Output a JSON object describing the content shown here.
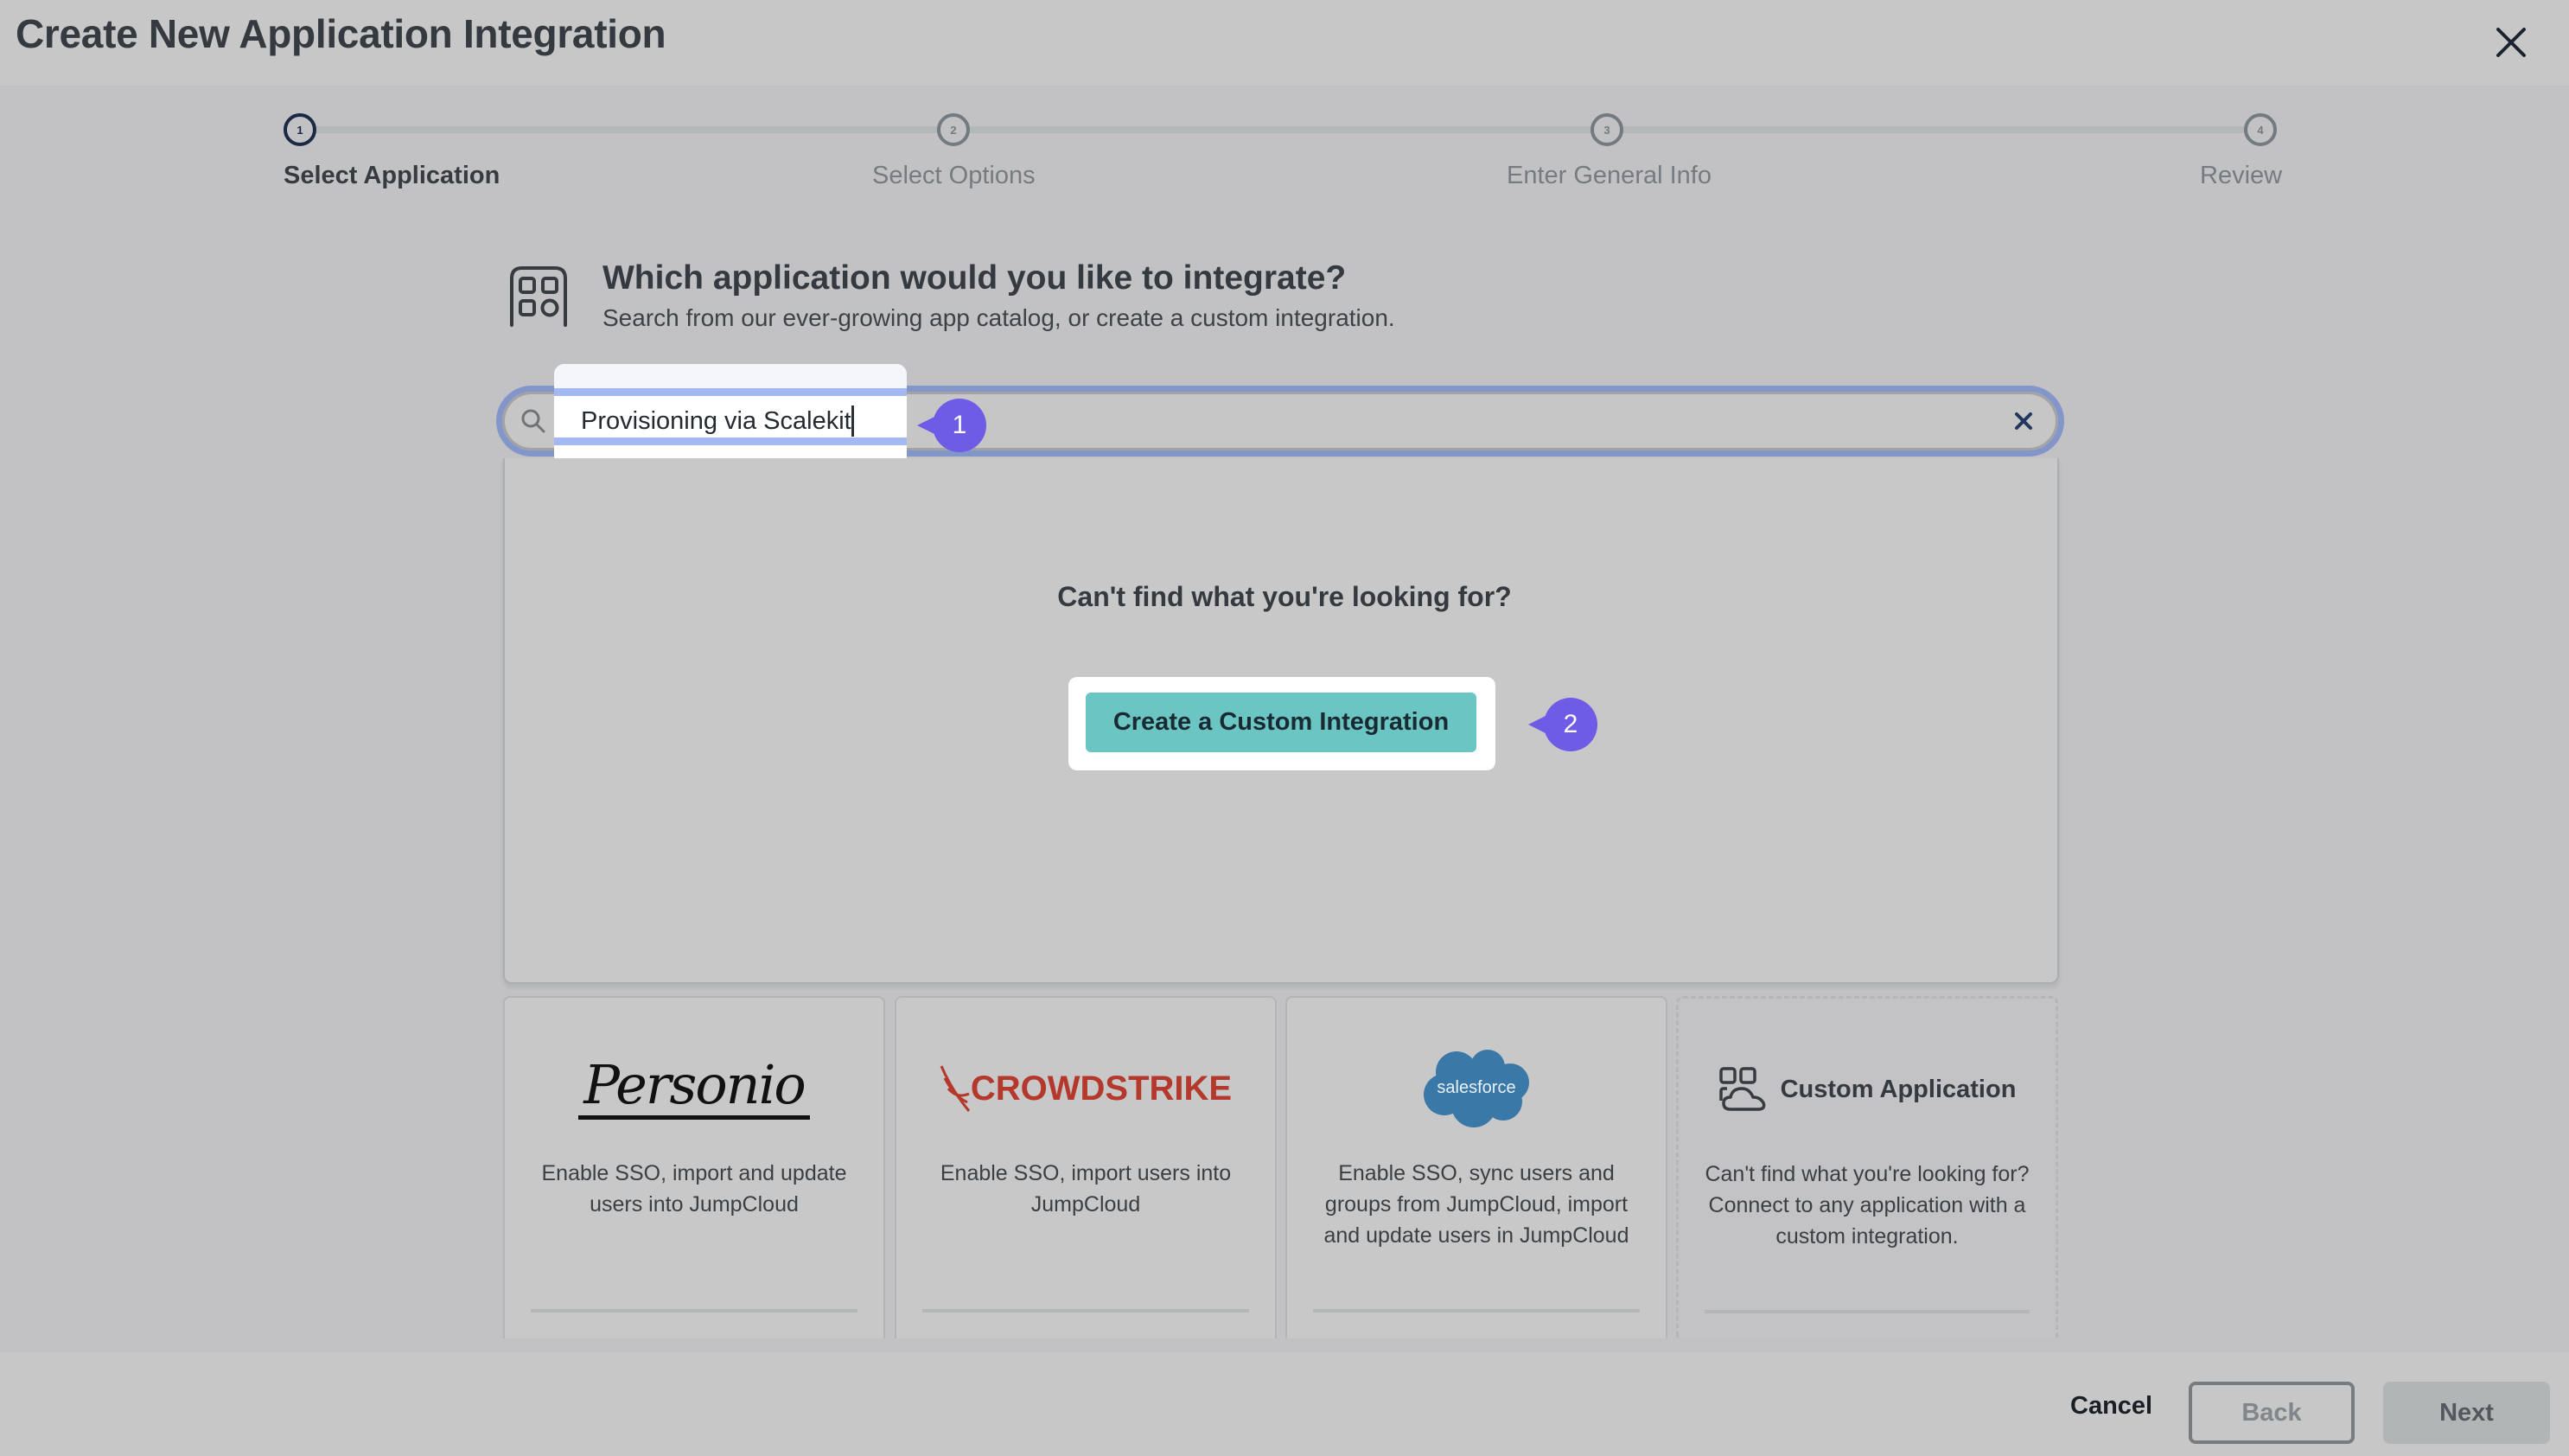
{
  "header": {
    "title": "Create New Application Integration",
    "close_icon": "close-icon"
  },
  "stepper": {
    "steps": [
      {
        "number": "1",
        "label": "Select Application",
        "active": true
      },
      {
        "number": "2",
        "label": "Select Options",
        "active": false
      },
      {
        "number": "3",
        "label": "Enter General Info",
        "active": false
      },
      {
        "number": "4",
        "label": "Review",
        "active": false
      }
    ]
  },
  "question": {
    "icon": "app-grid-icon",
    "title": "Which application would you like to integrate?",
    "subtitle": "Search from our ever-growing app catalog, or create a custom integration."
  },
  "search": {
    "value": "Provisioning via Scalekit",
    "icon": "search-icon",
    "clear_icon": "clear-icon"
  },
  "annotations": {
    "badge_1": "1",
    "badge_2": "2",
    "accent_color": "#6e5ce6"
  },
  "dropdown": {
    "empty_message": "Can't find what you're looking for?",
    "custom_button_label": "Create a Custom Integration",
    "custom_button_color": "#6bc5c2"
  },
  "cards": [
    {
      "name": "Personio",
      "logo_text": "Personio",
      "description": "Enable SSO, import and update users into JumpCloud"
    },
    {
      "name": "CrowdStrike",
      "logo_text": "CROWDSTRIKE",
      "description": "Enable SSO, import users into JumpCloud"
    },
    {
      "name": "Salesforce",
      "logo_text": "salesforce",
      "description": "Enable SSO, sync users and groups from JumpCloud, import and update users in JumpCloud"
    },
    {
      "name": "Custom Application",
      "logo_text": "Custom Application",
      "description": "Can't find what you're looking for? Connect to any application with a custom integration."
    }
  ],
  "footer": {
    "cancel_label": "Cancel",
    "back_label": "Back",
    "next_label": "Next"
  }
}
